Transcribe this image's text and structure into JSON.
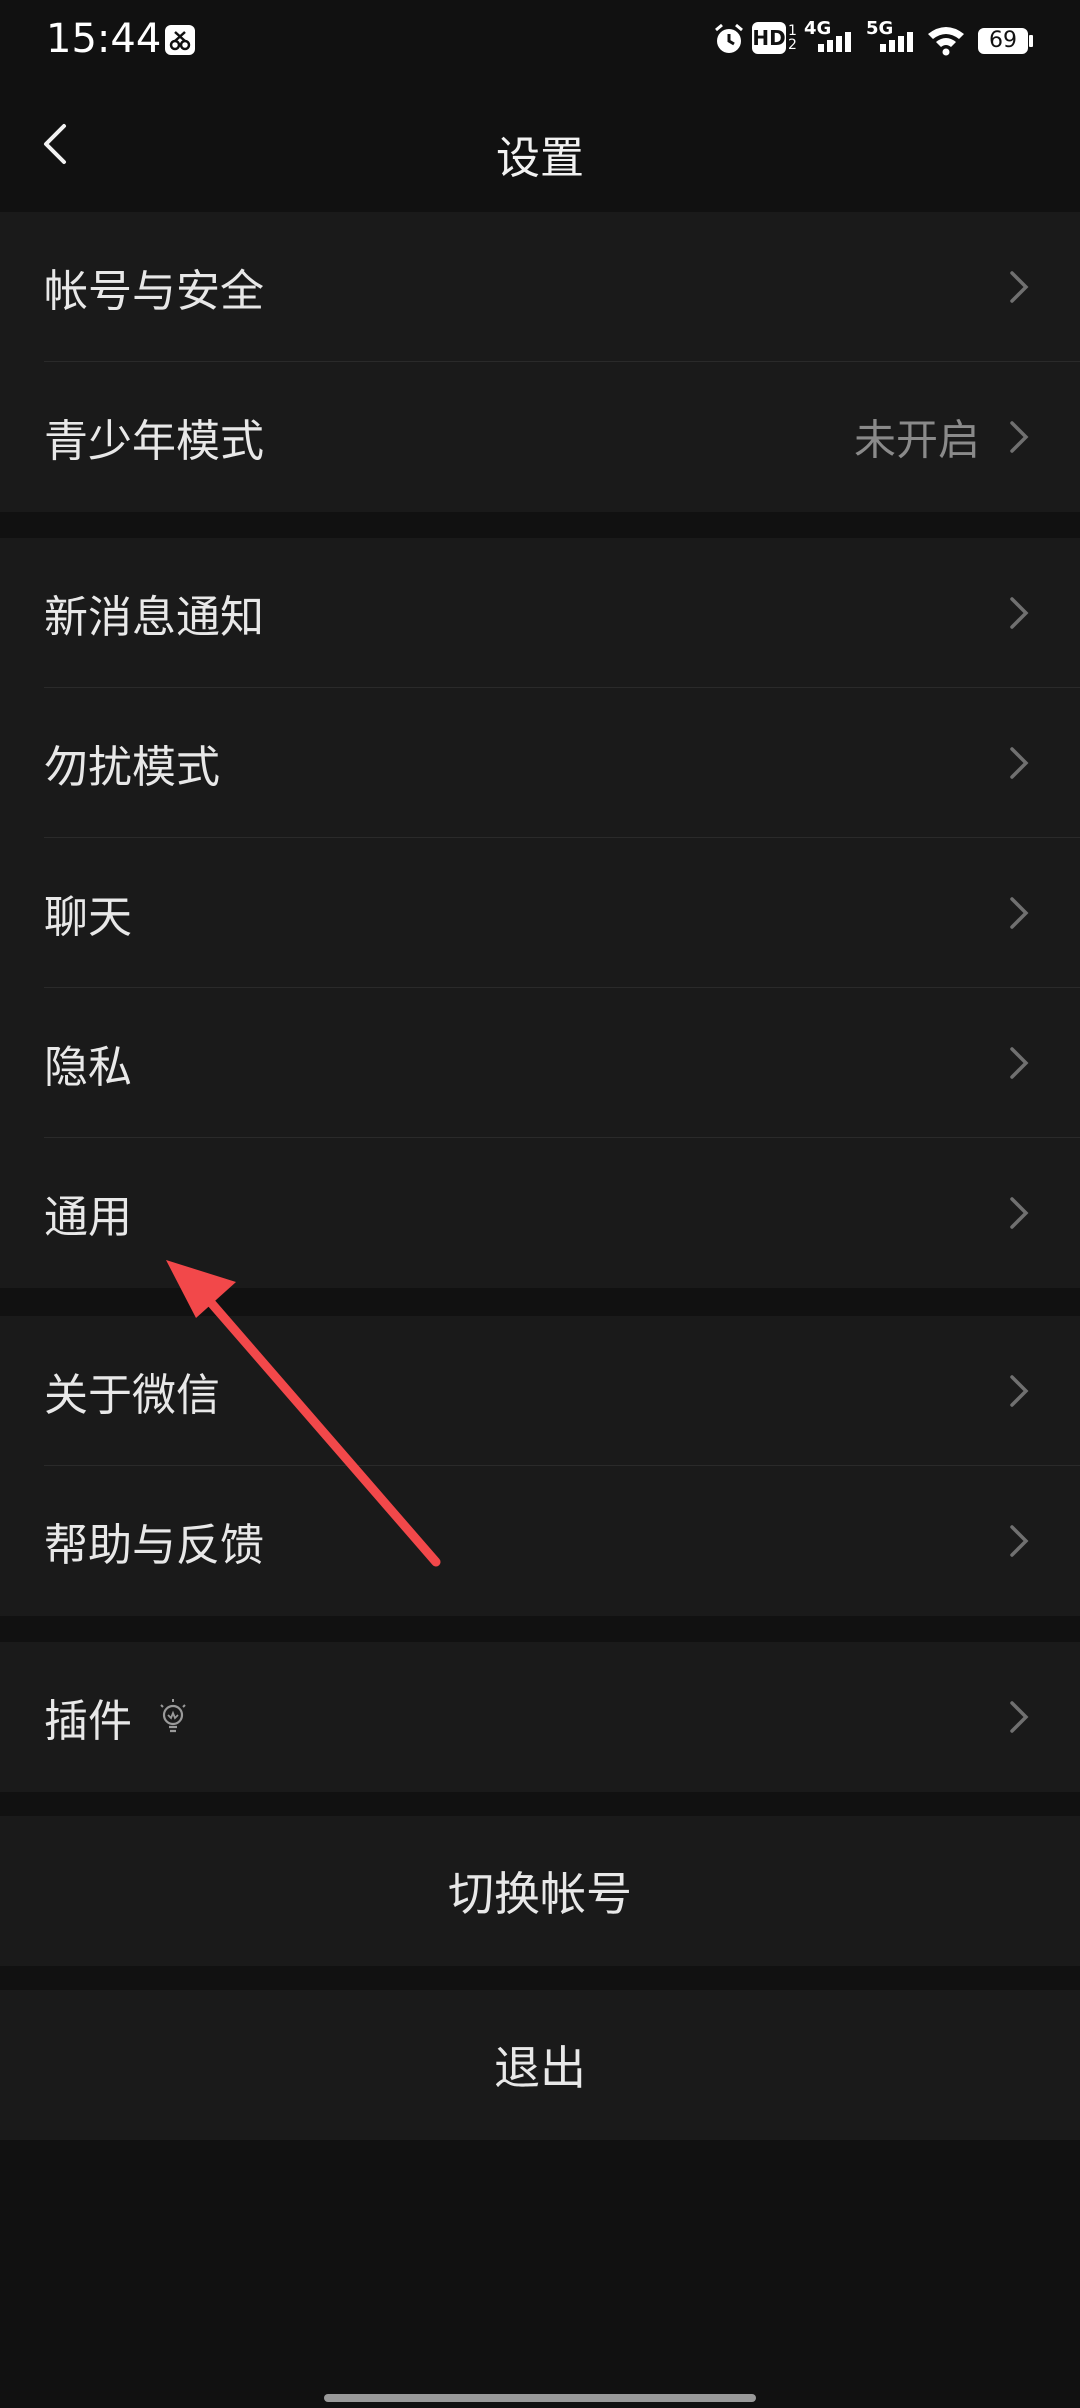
{
  "status_bar": {
    "time": "15:44",
    "hd_label": "HD",
    "signal_1": "4G",
    "signal_2": "5G",
    "battery": "69",
    "icons": [
      "scissors-app-icon",
      "alarm-icon",
      "hd-icon",
      "signal-4g-icon",
      "signal-5g-icon",
      "wifi-icon",
      "battery-icon"
    ]
  },
  "header": {
    "title": "设置"
  },
  "groups": [
    {
      "items": [
        {
          "label": "帐号与安全"
        },
        {
          "label": "青少年模式",
          "value": "未开启"
        }
      ]
    },
    {
      "items": [
        {
          "label": "新消息通知"
        },
        {
          "label": "勿扰模式"
        },
        {
          "label": "聊天"
        },
        {
          "label": "隐私"
        },
        {
          "label": "通用"
        }
      ]
    },
    {
      "items": [
        {
          "label": "关于微信"
        },
        {
          "label": "帮助与反馈"
        }
      ]
    },
    {
      "items": [
        {
          "label": "插件",
          "icon": "lightbulb-icon"
        }
      ]
    }
  ],
  "actions": {
    "switch_account": "切换帐号",
    "logout": "退出"
  },
  "colors": {
    "background": "#111111",
    "row": "#1a1a1a",
    "annotation_arrow": "#f2484a"
  }
}
